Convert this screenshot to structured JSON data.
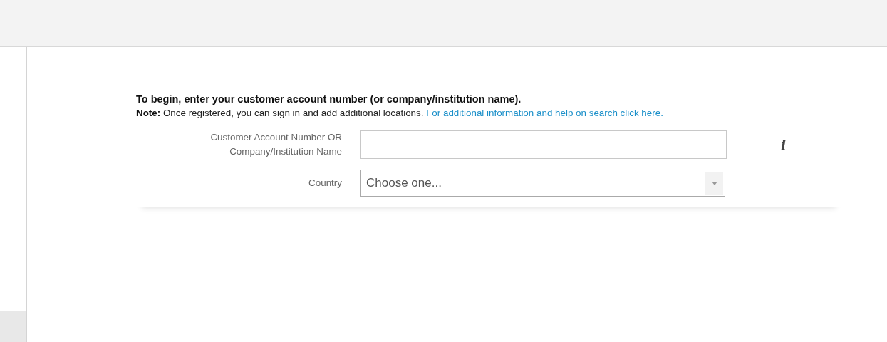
{
  "heading": "To begin, enter your customer account number (or company/institution name).",
  "note": {
    "label": "Note:",
    "text": "Once registered, you can sign in and add additional locations.",
    "link": "For additional information and help on search click here."
  },
  "fields": [
    {
      "kind": "text",
      "label": "Customer Account Number OR Company/Institution Name",
      "info": "i"
    },
    {
      "kind": "select",
      "label": "Country",
      "value": "Choose one..."
    }
  ]
}
